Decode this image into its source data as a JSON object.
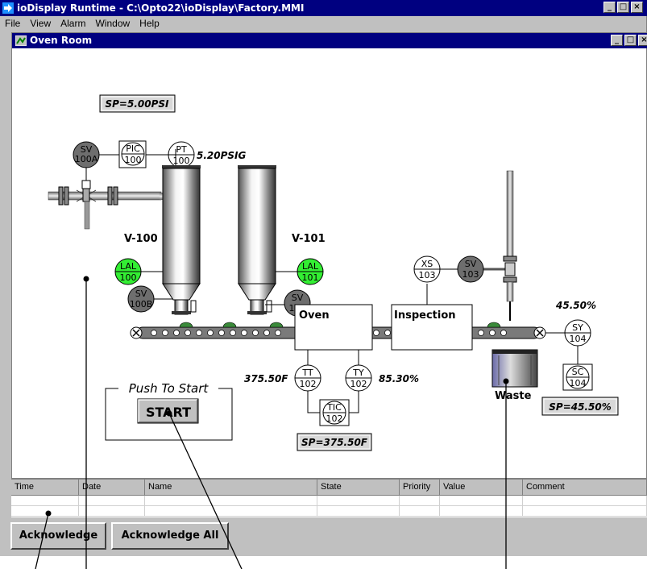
{
  "window": {
    "title": "ioDisplay Runtime - C:\\Opto22\\ioDisplay\\Factory.MMI",
    "min": "_",
    "max": "□",
    "close": "×"
  },
  "menu": [
    "File",
    "View",
    "Alarm",
    "Window",
    "Help"
  ],
  "child_window": {
    "title": "Oven Room"
  },
  "diagram": {
    "sp_psi": "SP=5.00PSI",
    "pressure_reading": "5.20PSIG",
    "sv100a": [
      "SV",
      "100A"
    ],
    "pic100": [
      "PIC",
      "100"
    ],
    "pt100": [
      "PT",
      "100"
    ],
    "v100": "V-100",
    "v101": "V-101",
    "lal100": [
      "LAL",
      "100"
    ],
    "lal101": [
      "LAL",
      "101"
    ],
    "sv100b": [
      "SV",
      "100B"
    ],
    "sv101": [
      "SV",
      "101"
    ],
    "xs103": [
      "XS",
      "103"
    ],
    "sv103": [
      "SV",
      "103"
    ],
    "oven": "Oven",
    "inspection": "Inspection",
    "sy_percent": "45.50%",
    "sy104": [
      "SY",
      "104"
    ],
    "sc104": [
      "SC",
      "104"
    ],
    "sp_percent": "SP=45.50%",
    "waste": "Waste",
    "tt102": [
      "TT",
      "102"
    ],
    "ty102": [
      "TY",
      "102"
    ],
    "tic102": [
      "TIC",
      "102"
    ],
    "temp_reading": "375.50F",
    "ty_percent": "85.30%",
    "sp_temp": "SP=375.50F",
    "push_to_start": "Push To Start",
    "start": "START"
  },
  "alarm_table": {
    "columns": [
      "Time",
      "Date",
      "Name",
      "State",
      "Priority",
      "Value",
      "Comment"
    ]
  },
  "buttons": {
    "acknowledge": "Acknowledge",
    "acknowledge_all": "Acknowledge All"
  },
  "colors": {
    "titlebar": "#000080",
    "alarm_green": "#33ee33",
    "valve_gray": "#6e6e6e",
    "chrome": "#c0c0c0"
  }
}
